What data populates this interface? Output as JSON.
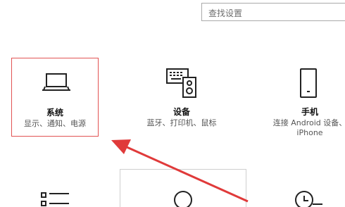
{
  "search": {
    "placeholder": "查找设置"
  },
  "tiles": [
    {
      "title": "系统",
      "subtitle": "显示、通知、电源",
      "icon": "laptop-icon"
    },
    {
      "title": "设备",
      "subtitle": "蓝牙、打印机、鼠标",
      "icon": "devices-icon"
    },
    {
      "title": "手机",
      "subtitle_line1": "连接 Android 设备、",
      "subtitle_line2": "iPhone",
      "icon": "phone-icon"
    }
  ],
  "row2_icons": [
    "apps-list-icon",
    "accounts-icon",
    "time-language-icon"
  ],
  "colors": {
    "accent": "#e25353",
    "selection_border": "#e25353",
    "arrow": "#e03a3a"
  }
}
